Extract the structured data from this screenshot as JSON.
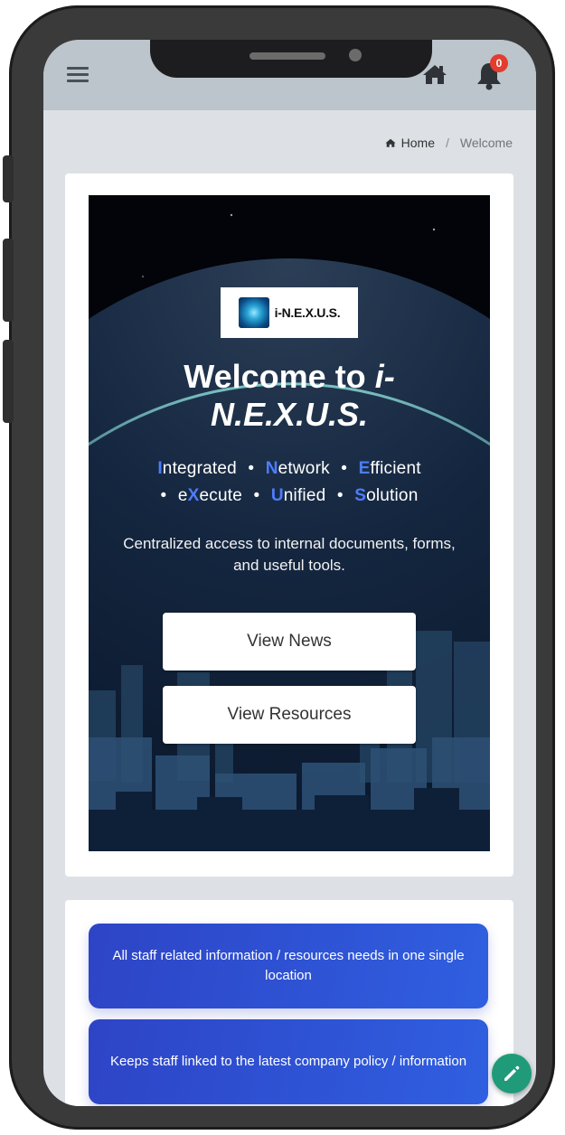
{
  "topbar": {
    "menu_icon": "hamburger-menu-icon",
    "home_icon": "home-icon",
    "bell_icon": "bell-icon",
    "notification_count": "0"
  },
  "breadcrumb": {
    "home_label": "Home",
    "separator": "/",
    "current": "Welcome"
  },
  "hero": {
    "logo_text": "i-N.E.X.U.S.",
    "title_prefix": "Welcome to ",
    "title_brand_line1": "i-",
    "title_brand_line2": "N.E.X.U.S.",
    "tagline_line1": [
      {
        "initial": "I",
        "rest": "ntegrated"
      },
      {
        "initial": "N",
        "rest": "etwork"
      },
      {
        "initial": "E",
        "rest": "fficient"
      }
    ],
    "tagline_line2": [
      {
        "prefix": "e",
        "initial": "X",
        "rest": "ecute"
      },
      {
        "initial": "U",
        "rest": "nified"
      },
      {
        "initial": "S",
        "rest": "olution"
      }
    ],
    "bullet": "•",
    "description": "Centralized access to internal documents, forms, and useful tools.",
    "buttons": {
      "news": "View News",
      "resources": "View Resources"
    }
  },
  "features": [
    "All staff related information / resources needs in one single location",
    "Keeps staff linked to the latest company policy / information"
  ],
  "fab": {
    "icon": "pencil-icon"
  },
  "colors": {
    "accent_letter": "#4d7dff",
    "feature_gradient_start": "#2e44c6",
    "feature_gradient_end": "#2f5fe0",
    "badge": "#e23d2d",
    "fab": "#1f9b7a"
  }
}
